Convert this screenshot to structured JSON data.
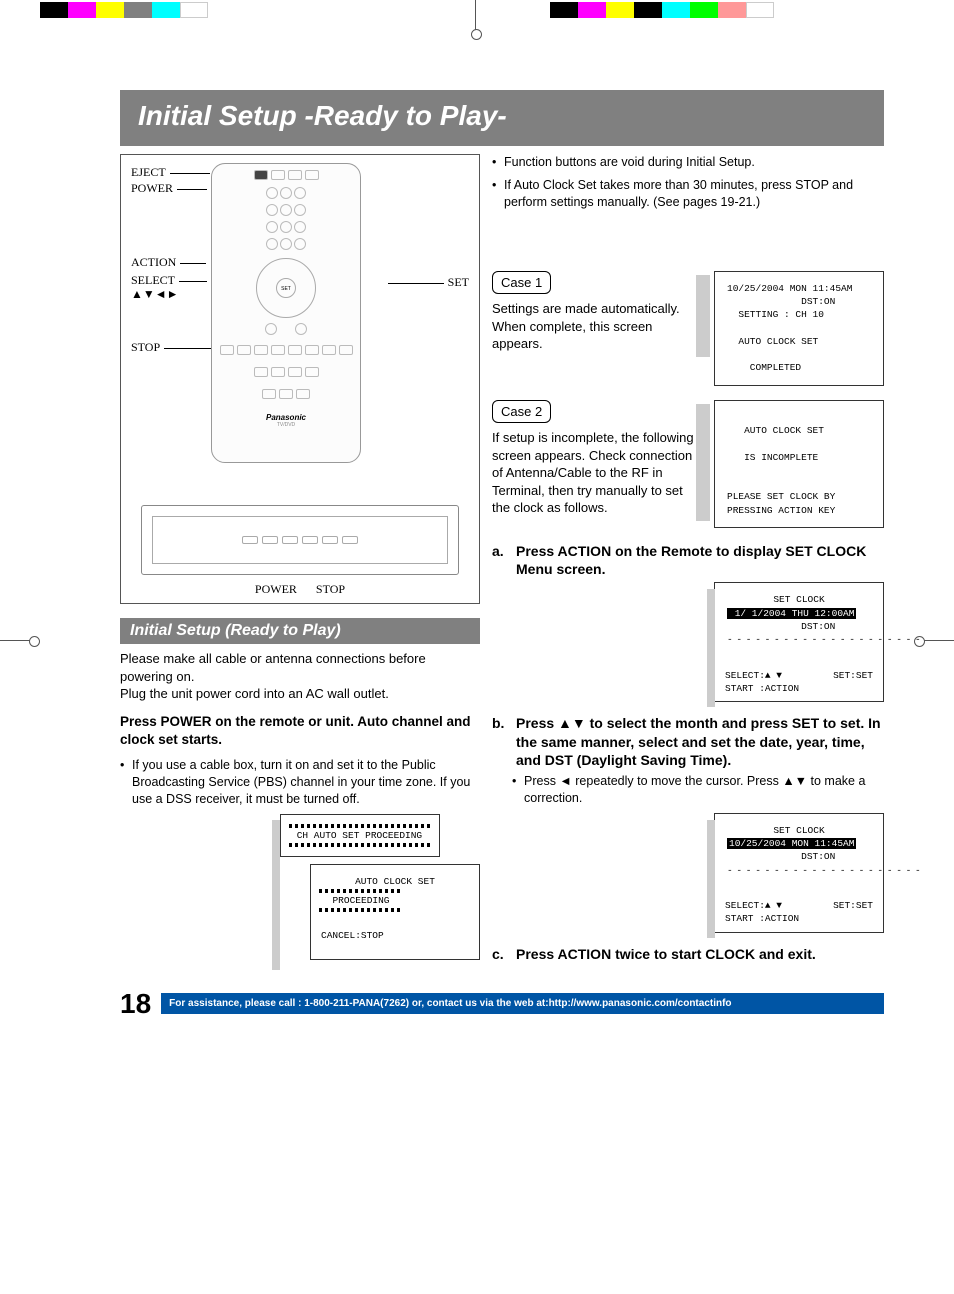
{
  "page_number": "18",
  "title": "Initial Setup -Ready to Play-",
  "remote": {
    "labels": {
      "eject": "EJECT",
      "power": "POWER",
      "action": "ACTION",
      "select": "SELECT",
      "arrows": "▲▼◄►",
      "stop": "STOP",
      "set": "SET"
    },
    "brand": "Panasonic",
    "model": "TV/DVD",
    "nav_center": "SET",
    "unit_labels": {
      "power": "POWER",
      "stop": "STOP"
    }
  },
  "subheader": "Initial Setup (Ready to Play)",
  "intro1": "Please make all cable or antenna connections before powering on.",
  "intro2": "Plug the unit power cord into an AC wall outlet.",
  "press_power": "Press POWER on the remote or unit. Auto channel and clock set starts.",
  "cable_note": "If you use a cable box, turn it on and set it to the Public Broadcasting Service (PBS) channel in your time zone. If you use a DSS receiver, it must be turned off.",
  "function_note": "Function buttons are void during Initial Setup.",
  "thirty_min_note": "If Auto Clock Set takes more than 30 minutes, press STOP and perform settings manually. (See pages 19-21.)",
  "case1": {
    "label": "Case 1",
    "desc": "Settings are made automatically. When complete, this screen appears.",
    "osd": {
      "l1": "10/25/2004 MON 11:45AM",
      "l2": "             DST:ON",
      "l3": "  SETTING : CH 10",
      "l4": "  AUTO CLOCK SET",
      "l5": "    COMPLETED"
    }
  },
  "case2": {
    "label": "Case 2",
    "desc": "If setup is incomplete, the following screen appears. Check connection of Antenna/Cable to the RF in Terminal, then try manually to set the clock as follows.",
    "osd": {
      "l1": "   AUTO CLOCK SET",
      "l2": "   IS INCOMPLETE",
      "l3": "PLEASE SET CLOCK BY",
      "l4": "PRESSING ACTION KEY"
    }
  },
  "proceeding_osd": {
    "box1": "CH AUTO SET PROCEEDING",
    "box2_l1": "AUTO CLOCK SET",
    "box2_l2": "PROCEEDING",
    "box2_l3": "CANCEL:STOP"
  },
  "steps": {
    "a": "Press ACTION on the Remote to display SET CLOCK Menu screen.",
    "a_osd": {
      "title": "SET CLOCK",
      "date": " 1/ 1/2004 THU 12:00AM",
      "dst": "             DST:ON",
      "sel": "SELECT:▲ ▼",
      "set": "SET:SET",
      "start": "START :ACTION"
    },
    "b": "Press ▲▼ to select the month and press SET to set. In the same manner, select and set the date, year, time, and DST (Daylight Saving Time).",
    "b_sub": "Press ◄ repeatedly to move the cursor. Press ▲▼ to make a correction.",
    "b_osd": {
      "title": "SET CLOCK",
      "date": "10/25/2004 MON 11:45AM",
      "dst": "             DST:ON",
      "sel": "SELECT:▲ ▼",
      "set": "SET:SET",
      "start": "START :ACTION"
    },
    "c": "Press ACTION twice to start CLOCK and exit."
  },
  "footer_bar": "For assistance, please call : 1-800-211-PANA(7262) or, contact us via the web at:http://www.panasonic.com/contactinfo"
}
